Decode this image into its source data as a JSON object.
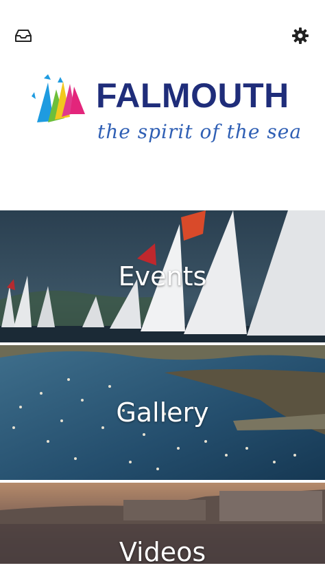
{
  "header": {
    "inbox_icon": "inbox-icon",
    "settings_icon": "gear-icon"
  },
  "logo": {
    "name": "FALMOUTH",
    "tagline": "the spirit of the sea"
  },
  "menu": {
    "events_label": "Events",
    "gallery_label": "Gallery",
    "videos_label": "Videos"
  },
  "colors": {
    "brand_navy": "#1f2d7a",
    "tagline_blue": "#2f5fb4",
    "label_white": "#ffffff"
  }
}
